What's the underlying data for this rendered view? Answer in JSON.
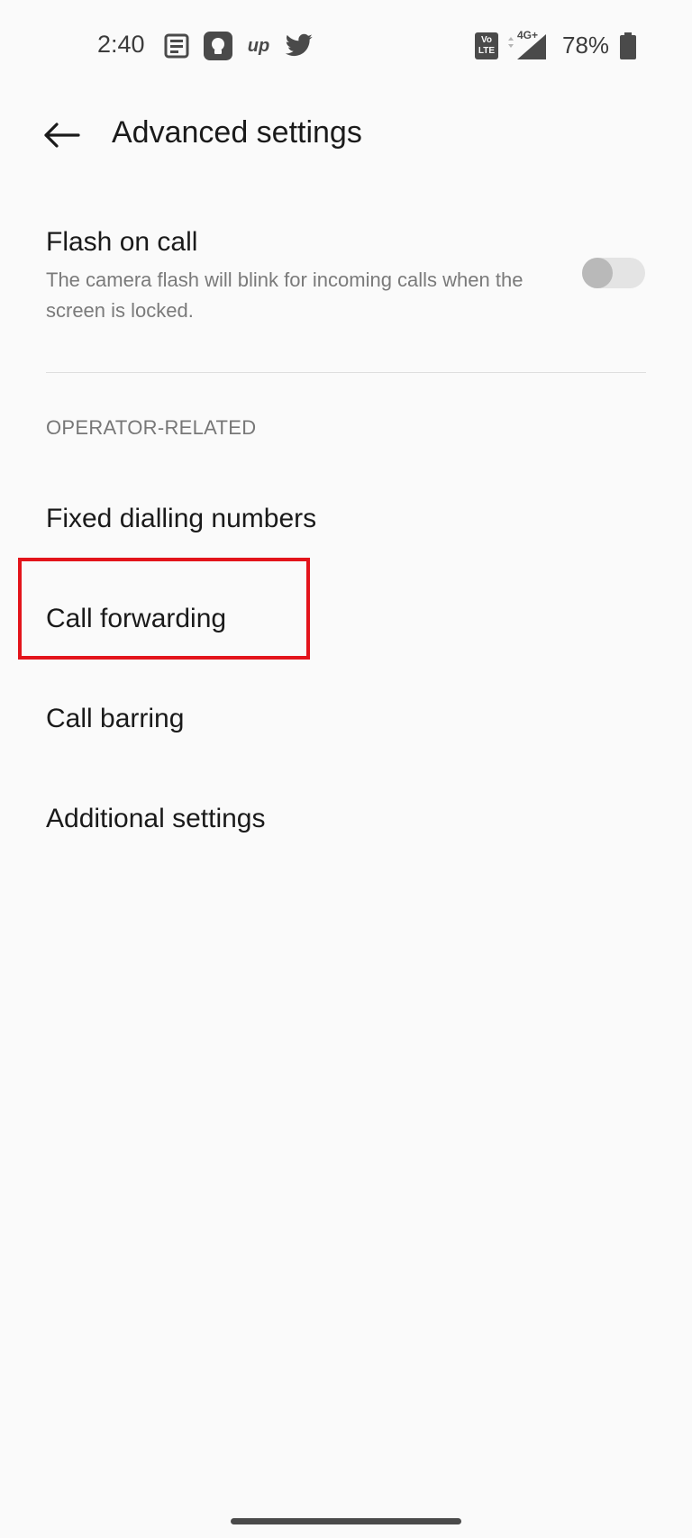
{
  "status_bar": {
    "time": "2:40",
    "battery": "78%",
    "network_badge": "4G+",
    "volte_badge_top": "Vo",
    "volte_badge_bottom": "LTE",
    "notif_app_label": "up",
    "icons": [
      "news-icon",
      "notification-app-icon",
      "up-app-icon",
      "twitter-icon",
      "volte-icon",
      "signal-icon",
      "battery-icon"
    ]
  },
  "toolbar": {
    "title": "Advanced settings",
    "back_icon": "arrow-left-icon"
  },
  "flash_on_call": {
    "title": "Flash on call",
    "description": "The camera flash will blink for incoming calls when the screen is locked.",
    "enabled": false
  },
  "section": {
    "header": "OPERATOR-RELATED"
  },
  "items": [
    {
      "label": "Fixed dialling numbers"
    },
    {
      "label": "Call forwarding"
    },
    {
      "label": "Call barring"
    },
    {
      "label": "Additional settings"
    }
  ],
  "colors": {
    "background": "#fafafa",
    "text_primary": "#1a1a1a",
    "text_secondary": "#7a7a7a",
    "highlight": "#e3141b"
  }
}
